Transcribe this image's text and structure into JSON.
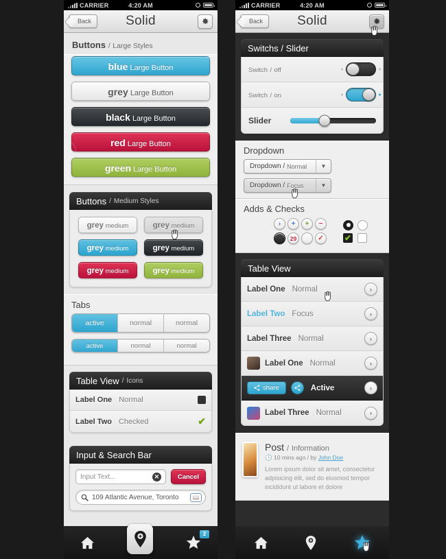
{
  "status_bar": {
    "carrier": "CARRIER",
    "time": "4:20 AM"
  },
  "navbar": {
    "back_label": "Back",
    "title": "Solid",
    "gear_icon": "gear-icon"
  },
  "left_phone": {
    "buttons_large": {
      "heading_main": "Buttons",
      "heading_sep": "/",
      "heading_sub": "Large Styles",
      "items": [
        {
          "em": "blue",
          "rest": "Large Button",
          "style": "blue"
        },
        {
          "em": "grey",
          "rest": "Large Button",
          "style": "grey"
        },
        {
          "em": "black",
          "rest": "Large Button",
          "style": "black"
        },
        {
          "em": "red",
          "rest": "Large Button",
          "style": "red"
        },
        {
          "em": "green",
          "rest": "Large Button",
          "style": "green"
        }
      ]
    },
    "buttons_medium": {
      "header_main": "Buttons",
      "header_sep": "/",
      "header_sub": "Medium Styles",
      "items": [
        {
          "em": "grey",
          "rest": "medium"
        },
        {
          "em": "grey",
          "rest": "medium"
        },
        {
          "em": "grey",
          "rest": "medium"
        },
        {
          "em": "grey",
          "rest": "medium"
        },
        {
          "em": "grey",
          "rest": "medium"
        },
        {
          "em": "grey",
          "rest": "medium"
        }
      ]
    },
    "tabs": {
      "heading": "Tabs",
      "row1": [
        "active",
        "normal",
        "normal"
      ],
      "row2": [
        "active",
        "normal",
        "normal"
      ]
    },
    "table_view": {
      "header_main": "Table View",
      "header_sep": "/",
      "header_sub": "Icons",
      "rows": [
        {
          "label": "Label One",
          "value": "Normal",
          "accessory": "checkbox-empty"
        },
        {
          "label": "Label Two",
          "value": "Checked",
          "accessory": "checkmark-green"
        }
      ]
    },
    "input_search": {
      "header": "Input & Search Bar",
      "input_placeholder": "Input Text...",
      "clear_icon": "clear-x-icon",
      "cancel_label": "Cancel",
      "search_value": "109 Atlantic Avenue, Toronto",
      "search_icon": "magnifier-icon",
      "bookmark_icon": "bookmark-icon"
    },
    "tabbar": [
      {
        "icon": "home-icon",
        "badge": ""
      },
      {
        "icon": "pin-plus-icon",
        "badge": ""
      },
      {
        "icon": "star-icon",
        "badge": "2"
      }
    ]
  },
  "right_phone": {
    "switches": {
      "header": "Switchs / Slider",
      "rows": [
        {
          "label": "Switch",
          "sep": "/",
          "state": "off"
        },
        {
          "label": "Switch",
          "sep": "/",
          "state": "on"
        }
      ],
      "slider_label": "Slider",
      "slider_value": 40
    },
    "dropdown": {
      "heading": "Dropdown",
      "items": [
        {
          "main": "Dropdown /",
          "sub": "Normal",
          "state": "normal"
        },
        {
          "main": "Dropdown /",
          "sub": "Focus",
          "state": "focus"
        }
      ]
    },
    "adds_checks": {
      "heading": "Adds & Checks",
      "row1": [
        {
          "name": "chevron-right-icon",
          "glyph": "›",
          "tone": "blue"
        },
        {
          "name": "plus-blue-icon",
          "glyph": "+",
          "tone": "blue"
        },
        {
          "name": "plus-green-icon",
          "glyph": "+",
          "tone": "green"
        },
        {
          "name": "minus-red-icon",
          "glyph": "−",
          "tone": "red"
        }
      ],
      "row2": [
        {
          "name": "filled-dark-circle-icon",
          "glyph": "",
          "tone": "dark"
        },
        {
          "name": "badge-count-icon",
          "glyph": "29",
          "tone": "badge"
        },
        {
          "name": "empty-circle-icon",
          "glyph": "",
          "tone": "plain"
        },
        {
          "name": "check-red-icon",
          "glyph": "✓",
          "tone": "red"
        }
      ],
      "radio_on": "radio-selected",
      "radio_off": "radio-empty",
      "check_on": "checkbox-checked",
      "check_off": "checkbox-empty"
    },
    "table_view": {
      "header": "Table View",
      "rows": [
        {
          "label": "Label One",
          "value": "Normal",
          "kind": "plain",
          "accessory": "disclosure-right"
        },
        {
          "label": "Label Two",
          "value": "Focus",
          "kind": "focus",
          "accessory": "disclosure-right"
        },
        {
          "label": "Label Three",
          "value": "Normal",
          "kind": "plain",
          "accessory": "disclosure-right"
        },
        {
          "label": "Label One",
          "value": "Normal",
          "kind": "thumb-a",
          "accessory": "disclosure-right"
        },
        {
          "label": "Active",
          "value": "",
          "kind": "active",
          "accessory": "disclosure-left",
          "share_label": "share"
        },
        {
          "label": "Label Three",
          "value": "Normal",
          "kind": "thumb-b",
          "accessory": "disclosure-right"
        }
      ]
    },
    "post": {
      "title": "Post",
      "sep": "/",
      "subtitle": "Information",
      "meta_time": "10 mins ago / by",
      "meta_author": "John Doe",
      "body": "Lorem ipsum dolor sit amet, consectetur adpisicing elit, sed do eiusmod tempor incididunt ut labore et dolore"
    },
    "tabbar": [
      {
        "icon": "home-icon",
        "active": false
      },
      {
        "icon": "pin-plus-icon",
        "active": false
      },
      {
        "icon": "star-icon",
        "active": true
      }
    ]
  },
  "colors": {
    "blue": "#2fa5cf",
    "red": "#c1123c",
    "green": "#8fb33c",
    "black": "#24282b",
    "dark_header": "#1d1d1d"
  }
}
